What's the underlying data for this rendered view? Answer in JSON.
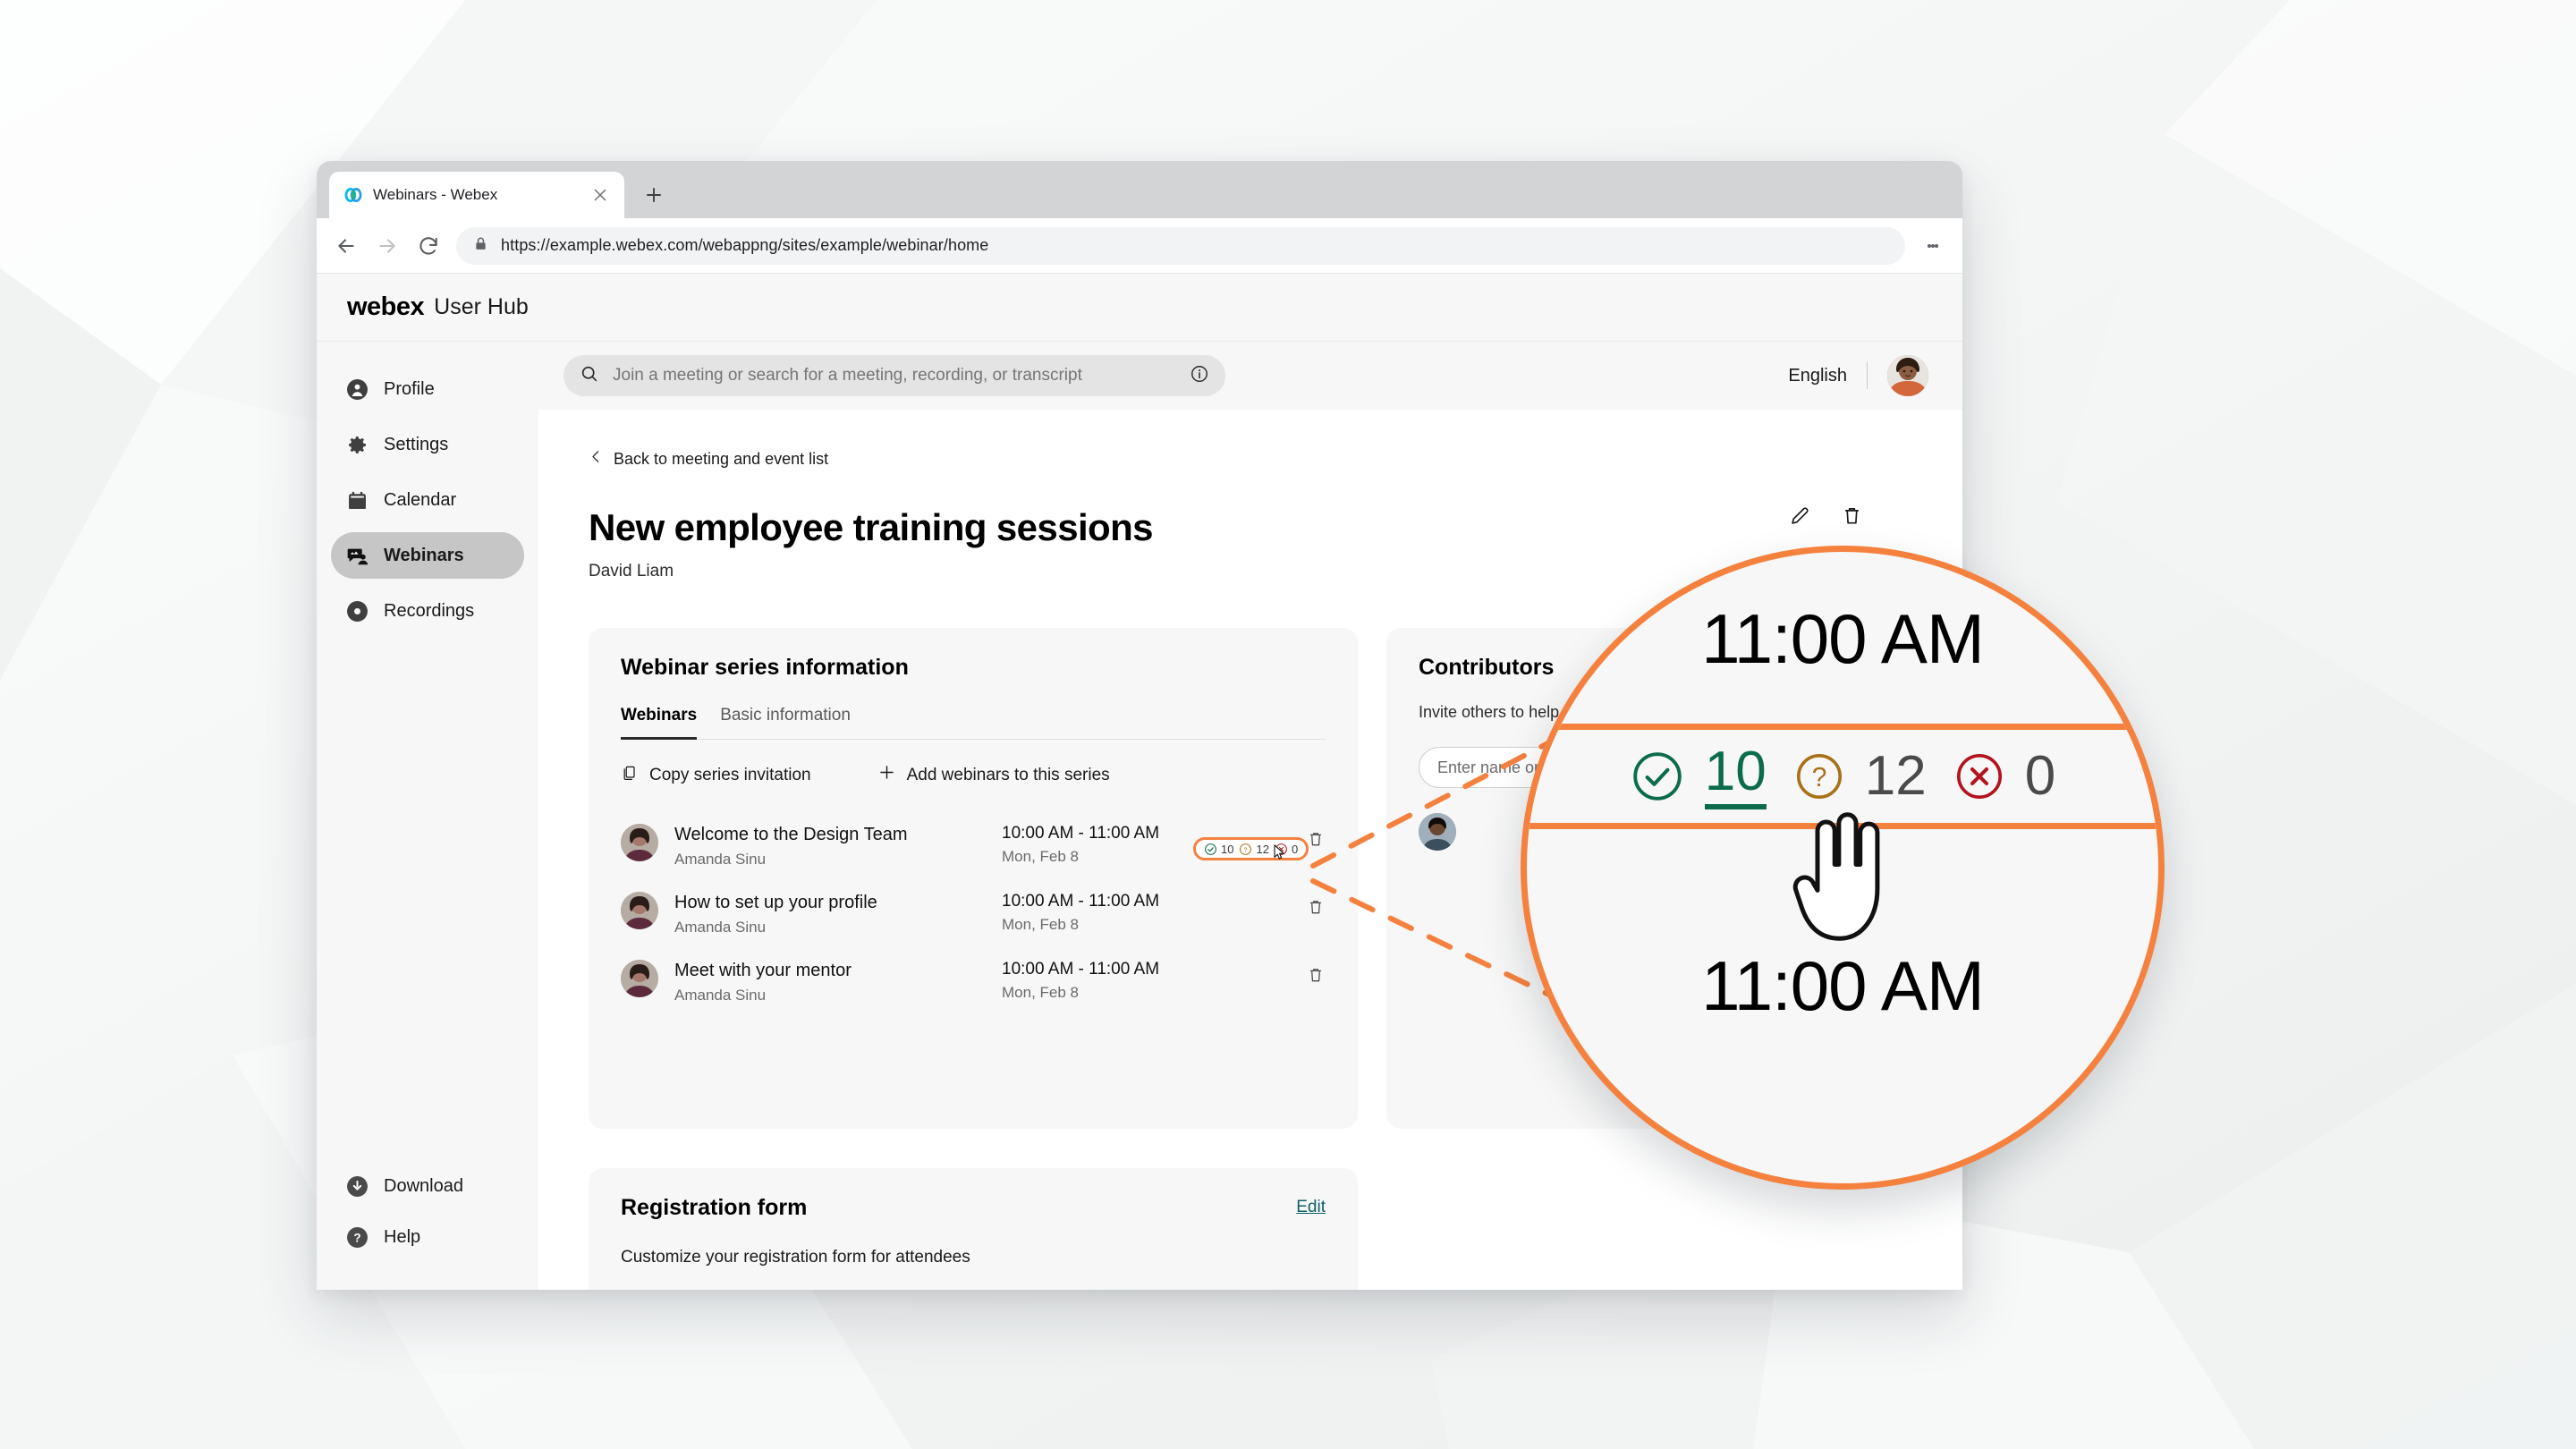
{
  "browser": {
    "tab": {
      "title": "Webinars - Webex",
      "favicon": "webex-logo-icon",
      "close": "×"
    },
    "new_tab_label": "+",
    "url": "https://example.webex.com/webappng/sites/example/webinar/home",
    "nav": {
      "back": "back-icon",
      "forward": "forward-icon",
      "reload": "reload-icon",
      "menu": "kebab-menu-icon"
    },
    "lock": "lock-icon"
  },
  "app": {
    "brand": "webex",
    "brand_sub": "User Hub"
  },
  "sidebar": {
    "items": [
      {
        "label": "Profile",
        "icon": "person-circle-icon",
        "active": false
      },
      {
        "label": "Settings",
        "icon": "gear-icon",
        "active": false
      },
      {
        "label": "Calendar",
        "icon": "calendar-icon",
        "active": false
      },
      {
        "label": "Webinars",
        "icon": "webinar-icon",
        "active": true
      },
      {
        "label": "Recordings",
        "icon": "record-circle-icon",
        "active": false
      }
    ],
    "bottom_items": [
      {
        "label": "Download",
        "icon": "download-circle-icon"
      },
      {
        "label": "Help",
        "icon": "help-circle-icon"
      }
    ]
  },
  "topbar": {
    "search_placeholder": "Join a meeting or search for a meeting, recording, or transcript",
    "search_value": "",
    "search_icon": "search-icon",
    "info_icon": "info-circle-icon",
    "language": "English",
    "avatar": "user-avatar"
  },
  "page": {
    "back_link": "Back to meeting and event list",
    "back_icon": "chevron-left-icon",
    "title": "New employee training sessions",
    "owner": "David Liam",
    "edit_icon": "pencil-icon",
    "delete_icon": "trash-icon"
  },
  "series_card": {
    "heading": "Webinar series information",
    "tabs": [
      {
        "label": "Webinars",
        "active": true
      },
      {
        "label": "Basic information",
        "active": false
      }
    ],
    "actions": [
      {
        "label": "Copy series invitation",
        "icon": "copy-icon"
      },
      {
        "label": "Add webinars to this series",
        "icon": "plus-icon"
      }
    ],
    "webinars": [
      {
        "name": "Welcome to the Design Team",
        "host": "Amanda Sinu",
        "time": "10:00 AM - 11:00 AM",
        "date": "Mon, Feb 8",
        "delete_icon": "trash-icon",
        "rsvp": {
          "accepted": "10",
          "tentative": "12",
          "declined": "0"
        }
      },
      {
        "name": "How to set up your profile",
        "host": "Amanda Sinu",
        "time": "10:00 AM - 11:00 AM",
        "date": "Mon, Feb 8",
        "delete_icon": "trash-icon",
        "rsvp": null
      },
      {
        "name": "Meet with your mentor",
        "host": "Amanda Sinu",
        "time": "10:00 AM - 11:00 AM",
        "date": "Mon, Feb 8",
        "delete_icon": "trash-icon",
        "rsvp": null
      }
    ]
  },
  "contributors_card": {
    "heading": "Contributors",
    "description": "Invite others to help with the program",
    "input_placeholder": "Enter name or email address",
    "person_avatar": "contributor-avatar"
  },
  "registration_card": {
    "heading": "Registration form",
    "edit_label": "Edit",
    "description": "Customize your registration form for attendees"
  },
  "magnifier": {
    "time_top": "11:00 AM",
    "time_bottom": "11:00 AM",
    "accepted_icon": "check-circle-icon",
    "accepted_count": "10",
    "tentative_icon": "question-circle-icon",
    "tentative_count": "12",
    "declined_icon": "x-circle-icon",
    "declined_count": "0",
    "cursor": "hand-pointer-cursor"
  },
  "colors": {
    "accent_orange": "#f5813f",
    "accepted_green": "#0b6b4b",
    "tentative_amber": "#a8711a",
    "declined_red": "#b3141f",
    "link_teal": "#10606b",
    "sidebar_active": "#c6c6c6"
  }
}
